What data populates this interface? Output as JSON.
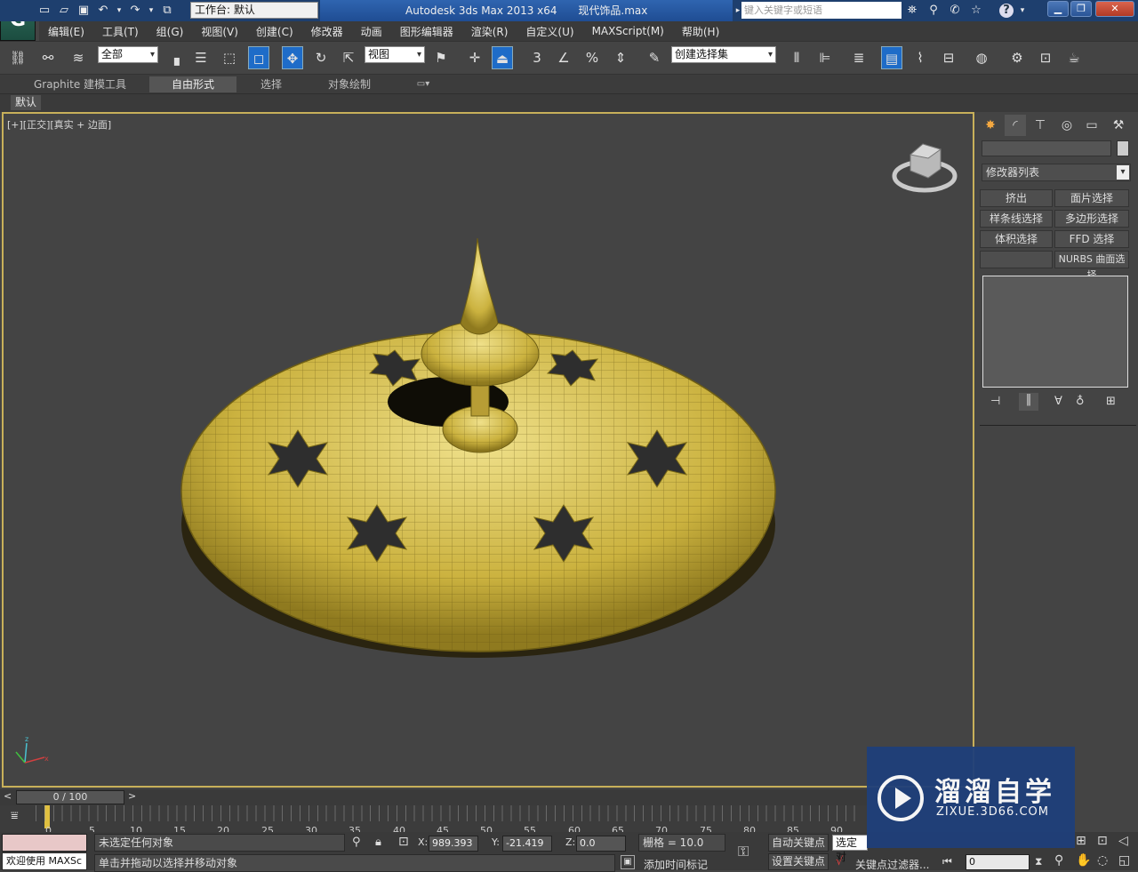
{
  "titlebar": {
    "app_title": "Autodesk 3ds Max  2013 x64",
    "file_name": "现代饰品.max",
    "workspace": "工作台: 默认",
    "search_placeholder": "键入关键字或短语"
  },
  "menu": [
    "编辑(E)",
    "工具(T)",
    "组(G)",
    "视图(V)",
    "创建(C)",
    "修改器",
    "动画",
    "图形编辑器",
    "渲染(R)",
    "自定义(U)",
    "MAXScript(M)",
    "帮助(H)"
  ],
  "toolbar": {
    "selection_filter": "全部",
    "ref_coord": "视图",
    "named_selection": "创建选择集"
  },
  "ribbon": {
    "tabs": [
      "Graphite 建模工具",
      "自由形式",
      "选择",
      "对象绘制"
    ],
    "active_tab": "自由形式",
    "panel_label": "默认"
  },
  "viewport": {
    "label": "[+][正交][真实 + 边面]"
  },
  "command_panel": {
    "modifier_list": "修改器列表",
    "buttons": [
      "挤出",
      "面片选择",
      "样条线选择",
      "多边形选择",
      "体积选择",
      "FFD 选择",
      "",
      "NURBS 曲面选择"
    ]
  },
  "timeline": {
    "frame_display": "0 / 100",
    "ticks": [
      "0",
      "5",
      "10",
      "15",
      "20",
      "25",
      "30",
      "35",
      "40",
      "45",
      "50",
      "55",
      "60",
      "65",
      "70",
      "75",
      "80",
      "85",
      "90"
    ]
  },
  "status": {
    "maxscript": "欢迎使用 MAXSc",
    "selection_status": "未选定任何对象",
    "prompt": "单击并拖动以选择并移动对象",
    "x_label": "X:",
    "x_value": "989.393",
    "y_label": "Y:",
    "y_value": "-21.419",
    "z_label": "Z:",
    "z_value": "0.0",
    "grid": "栅格 = 10.0",
    "auto_key": "自动关键点",
    "set_key": "设置关键点",
    "selected_dropdown": "选定对",
    "key_filters": "关键点过滤器...",
    "add_time_tag": "添加时间标记",
    "frame_input": "0"
  },
  "watermark": {
    "brand": "溜溜自学",
    "url": "ZIXUE.3D66.COM"
  }
}
